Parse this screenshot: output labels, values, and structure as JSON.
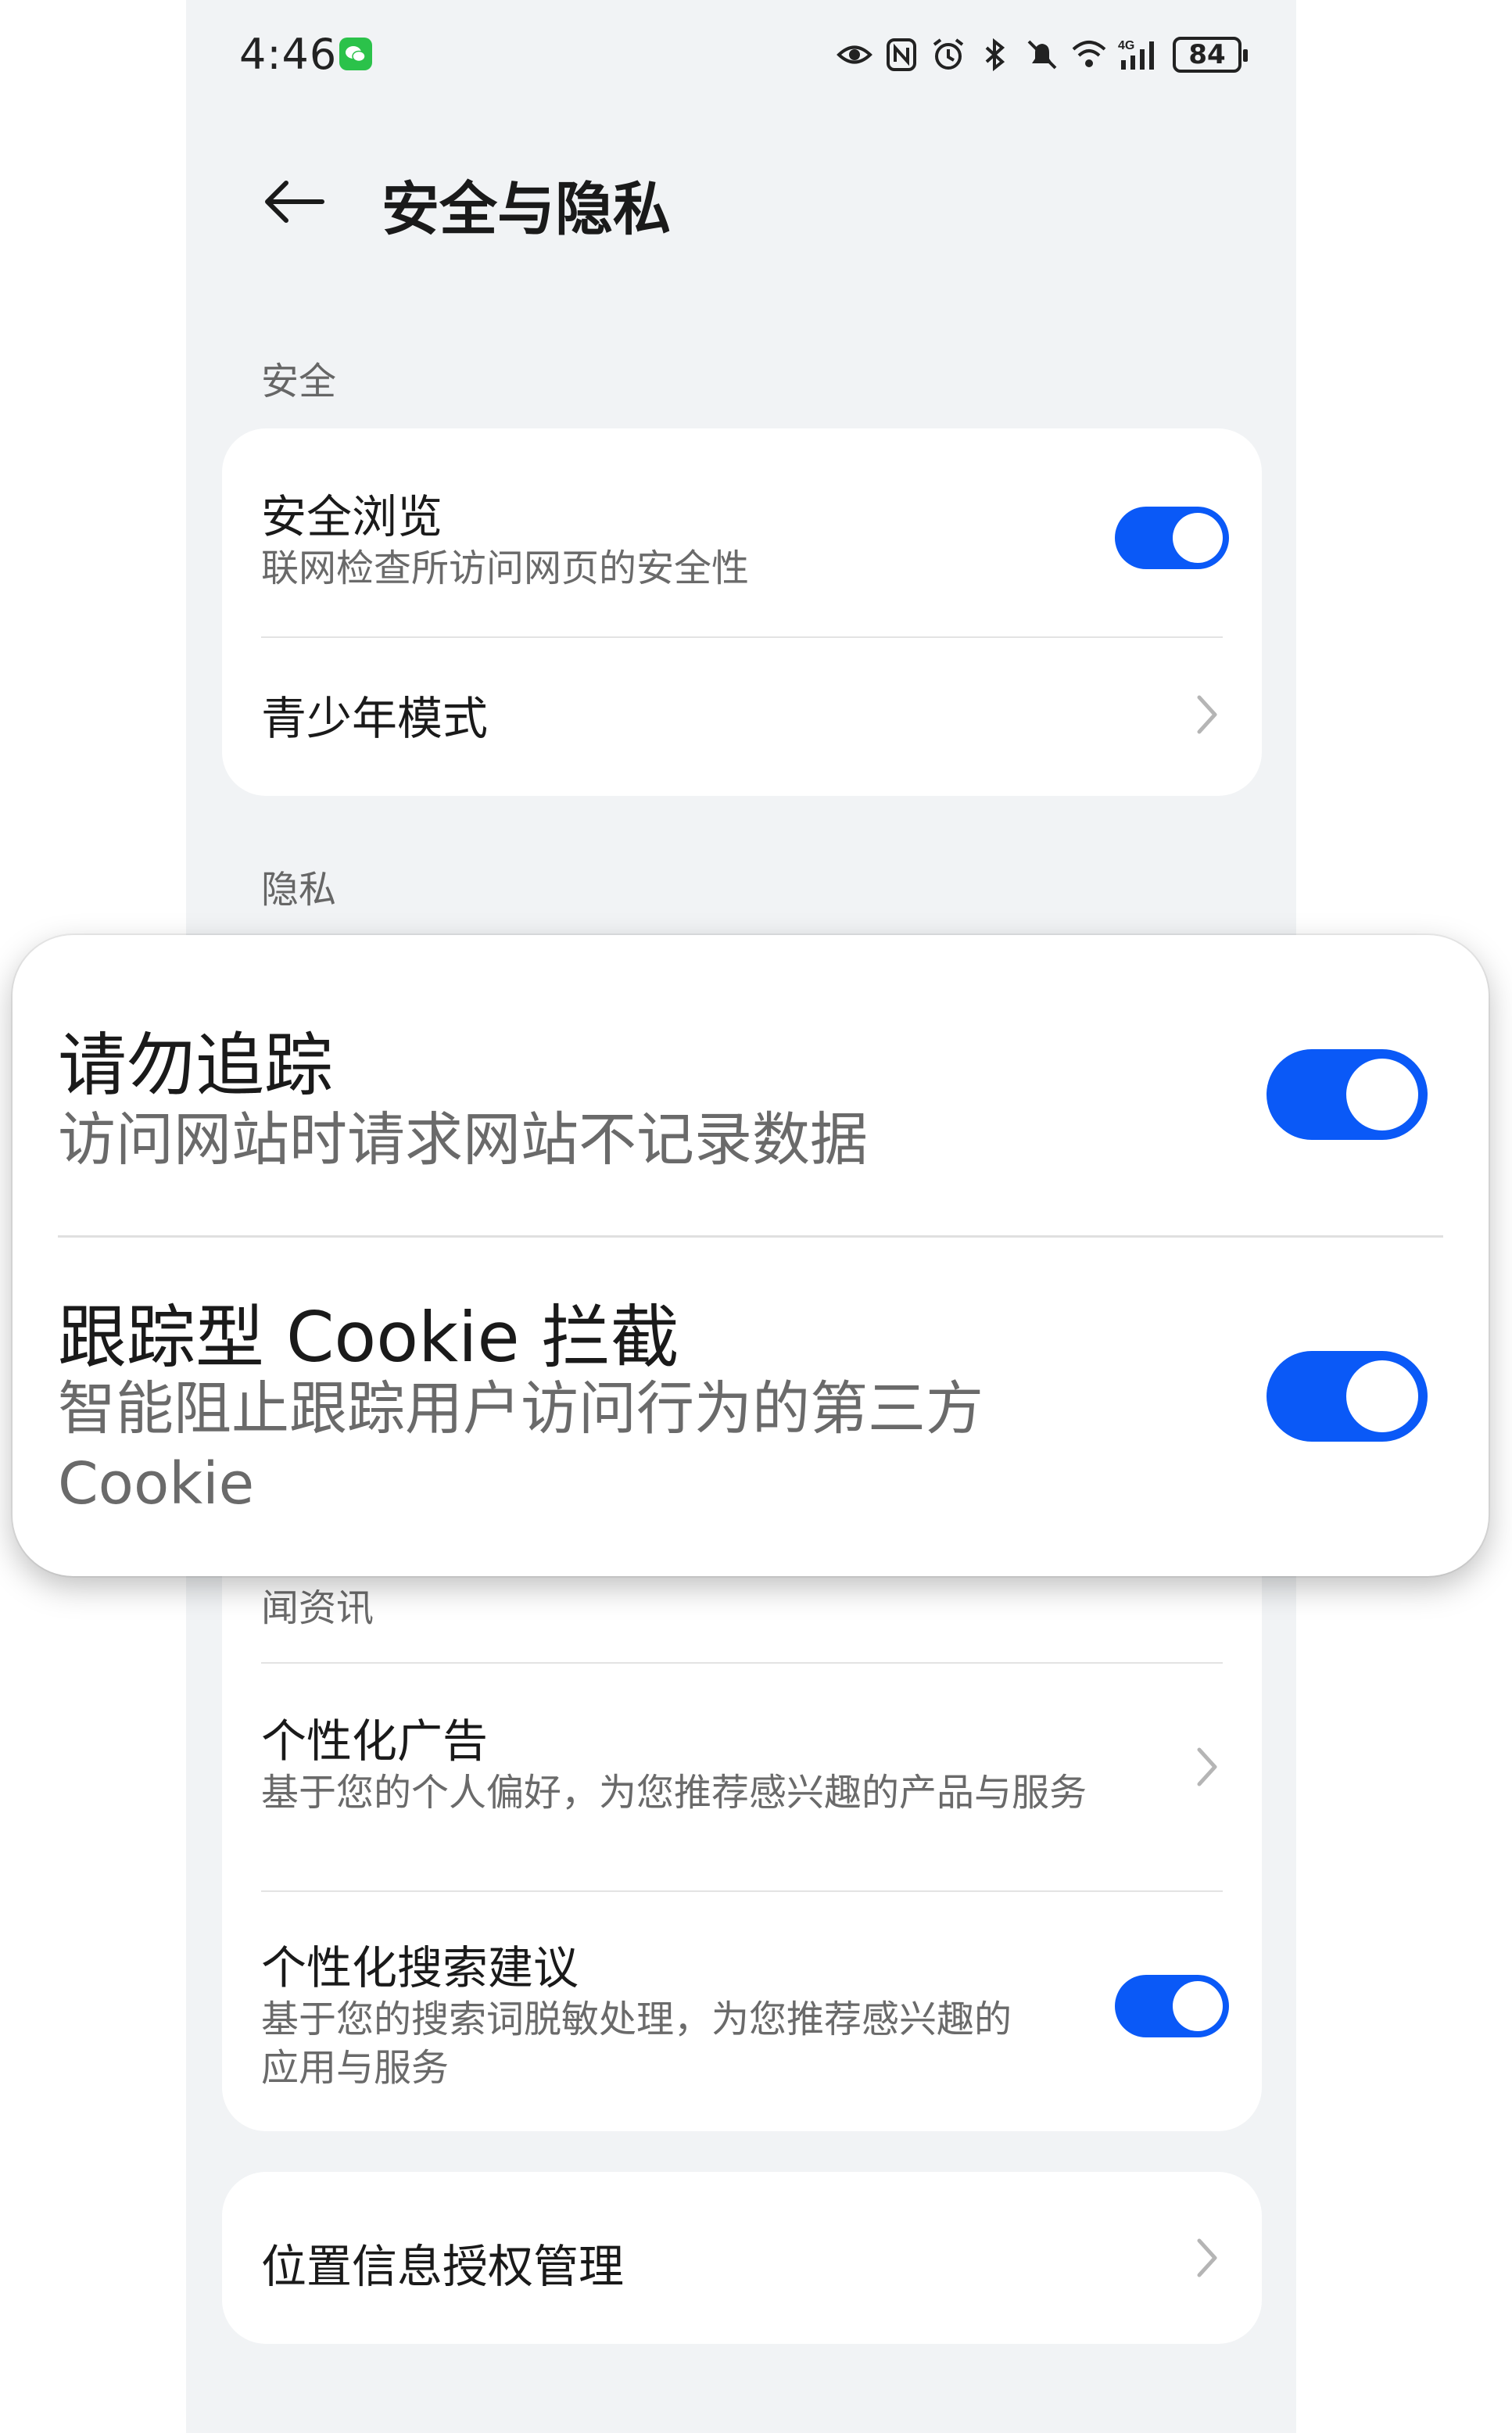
{
  "status_bar": {
    "time": "4:46",
    "battery": "84",
    "icons": [
      "wechat-icon",
      "eye-icon",
      "nfc-icon",
      "alarm-icon",
      "bluetooth-icon",
      "mute-icon",
      "wifi-icon",
      "signal-4g-icon"
    ]
  },
  "header": {
    "title": "安全与隐私"
  },
  "security": {
    "label": "安全",
    "safe_browsing": {
      "title": "安全浏览",
      "subtitle": "联网检查所访问网页的安全性",
      "enabled": true
    },
    "teen_mode": {
      "title": "青少年模式"
    }
  },
  "privacy": {
    "label": "隐私",
    "partial_subtitle": "闻资讯",
    "personalized_ads": {
      "title": "个性化广告",
      "subtitle": "基于您的个人偏好，为您推荐感兴趣的产品与服务"
    },
    "personalized_search": {
      "title": "个性化搜索建议",
      "subtitle": "基于您的搜索词脱敏处理，为您推荐感兴趣的应用与服务",
      "enabled": true
    }
  },
  "location": {
    "title": "位置信息授权管理"
  },
  "zoom": {
    "do_not_track": {
      "title": "请勿追踪",
      "subtitle": "访问网站时请求网站不记录数据",
      "enabled": true
    },
    "cookie_block": {
      "title": "跟踪型 Cookie 拦截",
      "subtitle": "智能阻止跟踪用户访问行为的第三方Cookie",
      "enabled": true
    }
  },
  "colors": {
    "accent": "#0a59f7",
    "background": "#f1f3f5",
    "card": "#ffffff"
  }
}
